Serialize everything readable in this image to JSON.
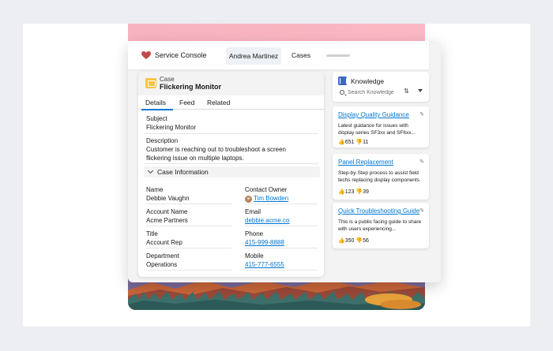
{
  "app": {
    "name": "Service Console",
    "tabs": [
      "Andrea Martinez",
      "Cases"
    ]
  },
  "case": {
    "label": "Case",
    "title": "Flickering Monitor",
    "tabs": [
      "Details",
      "Feed",
      "Related"
    ],
    "subject_label": "Subject",
    "subject": "Flickering Monitor",
    "description_label": "Description",
    "description": "Customer is reaching out to troubleshoot a screen flickering issue on multiple laptops.",
    "section_title": "Case Information",
    "fields": {
      "name_label": "Name",
      "name": "Debbie Vaughn",
      "owner_label": "Contact Owner",
      "owner": "Tim Bowden",
      "account_label": "Account Name",
      "account": "Acme Partners",
      "email_label": "Email",
      "email": "debbie.acme.co",
      "title_label": "Title",
      "title": "Account Rep",
      "phone_label": "Phone",
      "phone": "415-999-8888",
      "department_label": "Department",
      "department": "Operations",
      "mobile_label": "Mobile",
      "mobile": "415-777-6555"
    }
  },
  "knowledge": {
    "title": "Knowledge",
    "search_placeholder": "Search Knowledge",
    "articles": [
      {
        "title": "Display Quality Guidance",
        "desc": "Latest guidance for issues with display series SF3xx and SF6xx...",
        "up": "651",
        "down": "11"
      },
      {
        "title": "Panel Replacement",
        "desc": "Step-by-Step process to assist field techs replacing display components",
        "up": "123",
        "down": "39"
      },
      {
        "title": "Quick Troubleshooting Guide",
        "desc": "This is a public facing guide to share with users experiencing...",
        "up": "350",
        "down": "56"
      }
    ]
  },
  "colors": {
    "brand": "#0176d3",
    "case_icon": "#f6c544",
    "knowledge_icon": "#3c67c5",
    "accent_pink": "#f7b3bf"
  }
}
